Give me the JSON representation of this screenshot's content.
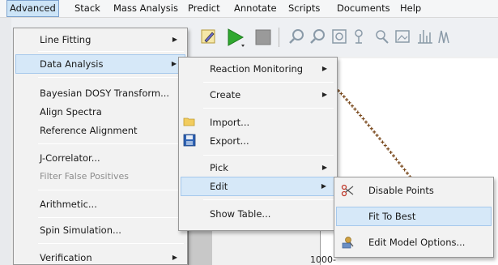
{
  "menubar": {
    "items": [
      "Advanced",
      "Stack",
      "Mass Analysis",
      "Predict",
      "Annotate",
      "Scripts",
      "Documents",
      "Help"
    ]
  },
  "advanced_menu": {
    "items": [
      {
        "label": "Line Fitting",
        "submenu": true
      },
      {
        "label": "Data Analysis",
        "submenu": true,
        "highlighted": true
      },
      {
        "label": "Bayesian DOSY Transform..."
      },
      {
        "label": "Align Spectra"
      },
      {
        "label": "Reference Alignment"
      },
      {
        "label": "J-Correlator..."
      },
      {
        "label": "Filter False Positives",
        "disabled": true
      },
      {
        "label": "Arithmetic..."
      },
      {
        "label": "Spin Simulation..."
      },
      {
        "label": "Verification",
        "submenu": true
      }
    ]
  },
  "data_analysis_menu": {
    "items": [
      {
        "label": "Reaction Monitoring",
        "submenu": true
      },
      {
        "label": "Create",
        "submenu": true
      },
      {
        "label": "Import...",
        "icon": "folder-icon"
      },
      {
        "label": "Export...",
        "icon": "floppy-disk-icon"
      },
      {
        "label": "Pick",
        "submenu": true
      },
      {
        "label": "Edit",
        "submenu": true,
        "highlighted": true
      },
      {
        "label": "Show Table..."
      }
    ]
  },
  "edit_menu": {
    "items": [
      {
        "label": "Disable Points",
        "icon": "scissors-icon"
      },
      {
        "label": "Fit To Best",
        "highlighted": true
      },
      {
        "label": "Edit Model Options...",
        "icon": "model-options-icon"
      }
    ]
  },
  "plot": {
    "y_tick_label": "1000-"
  },
  "colors": {
    "accent_highlight": "#d6e8f8",
    "highlight_border": "#a5c8ec",
    "plot_points": "#7a4a1e"
  }
}
